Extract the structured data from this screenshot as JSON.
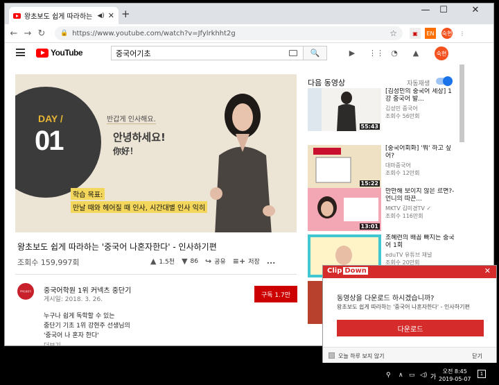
{
  "browser": {
    "tab_title": "왕초보도 쉽게 따라하는 '중",
    "url": "https://www.youtube.com/watch?v=Jfylrkhht2g",
    "ext_badge": "EN",
    "profile": "숙현"
  },
  "youtube": {
    "logo_text": "YouTube",
    "search_value": "중국어기초",
    "avatar_text": "숙현"
  },
  "video": {
    "slide": {
      "day_label": "DAY",
      "day_slash": "/",
      "day_number": "01",
      "bubble": "반갑게 인사해요.",
      "hello_ko": "안녕하세요!",
      "hello_zh": "你好！",
      "goal_label": "학습 목표:",
      "goal_text": "만날 때와 헤어질 때 인사, 시간대별 인사 익히"
    },
    "title": "왕초보도 쉽게 따라하는 '중국어 나혼자한다' - 인사하기편",
    "views": "조회수 159,997회",
    "likes": "1.5천",
    "dislikes": "86",
    "share": "공유",
    "save": "저장",
    "more": "..."
  },
  "channel": {
    "avatar_text": "커넥츠중단기",
    "name": "중국어학원 1위 커넥츠 중단기",
    "published": "게시일: 2018. 3. 26.",
    "subscribe": "구독 1.7만",
    "description": [
      "누구나 쉽게 독학할 수 있는",
      "중단기 기초 1위 강현주 선생님의",
      "'중국어 나 혼자 한다'"
    ],
    "more": "더보기"
  },
  "sidebar": {
    "up_next": "다음 동영상",
    "autoplay": "자동재생",
    "items": [
      {
        "title": "[김성민의 중국어 세상] 1강 중국어 발...",
        "channel": "김성민 중국어",
        "views": "조회수 56만회",
        "duration": "55:43"
      },
      {
        "title": "[중국어회화] '뭐' 하고 싶어?",
        "channel": "대마중국어",
        "views": "조회수 12만회",
        "duration": "15:22"
      },
      {
        "title": "만만해 보이지 않은 르면?-언니의 따끈...",
        "channel": "MKTV 김미경TV ✓",
        "views": "조회수 116만회",
        "duration": "13:01"
      },
      {
        "title": "조혜련의 배꼽 빠지는 중국어 1회",
        "channel": "eduTV 유튜브 채널",
        "views": "조회수 20만회",
        "duration": ""
      }
    ]
  },
  "clipdown": {
    "logo_a": "Clip",
    "logo_b": "Down",
    "question": "동영상을 다운로드 하시겠습니까?",
    "video_title": "왕초보도 쉽게 따라하는 '중국어 나혼자한다' - 인사하기편",
    "download": "다운로드",
    "dont_show": "오늘 하루 보지 않기",
    "close": "닫기"
  },
  "taskbar": {
    "time": "오전 8:45",
    "date": "2019-05-07",
    "ime": "가",
    "notifications": "1"
  }
}
